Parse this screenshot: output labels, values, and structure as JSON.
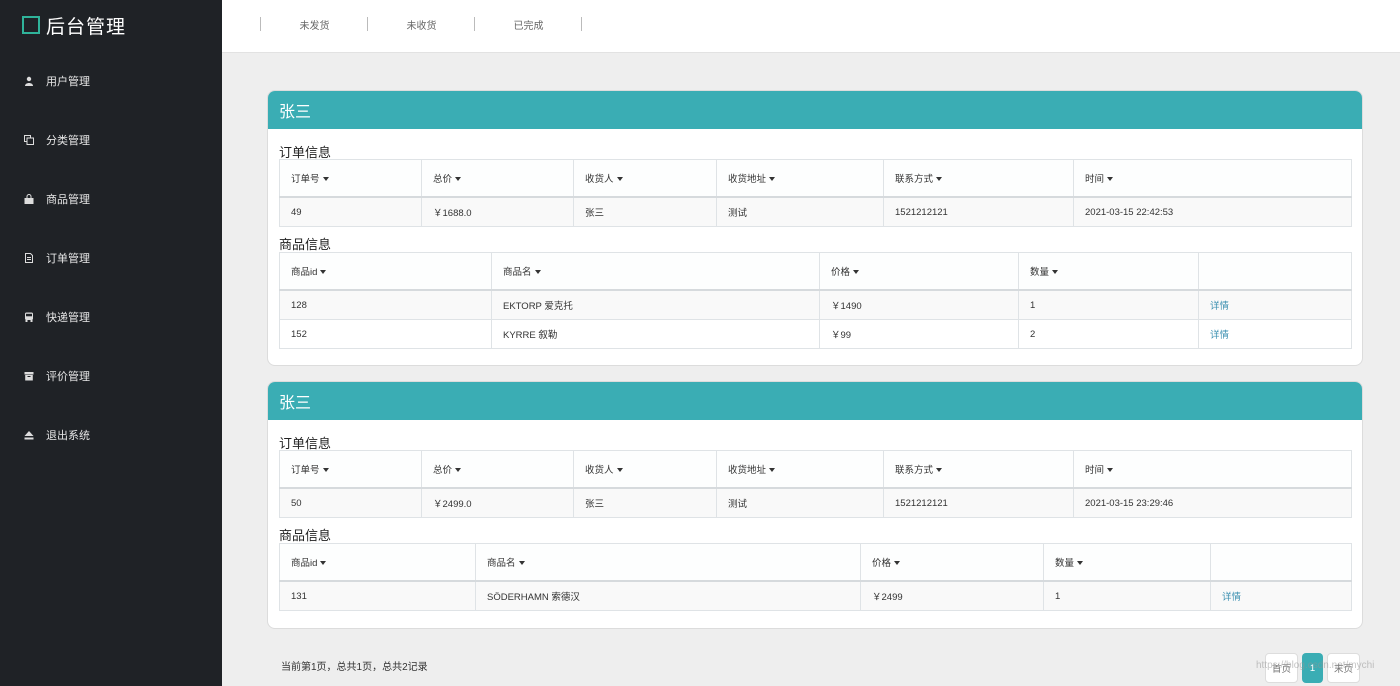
{
  "app": {
    "title": "后台管理"
  },
  "sidebar": {
    "items": [
      {
        "label": "用户管理",
        "icon": "user-icon"
      },
      {
        "label": "分类管理",
        "icon": "copy-icon"
      },
      {
        "label": "商品管理",
        "icon": "shopping-bag-icon"
      },
      {
        "label": "订单管理",
        "icon": "document-icon"
      },
      {
        "label": "快递管理",
        "icon": "bus-icon"
      },
      {
        "label": "评价管理",
        "icon": "archive-icon"
      },
      {
        "label": "退出系统",
        "icon": "eject-icon"
      }
    ]
  },
  "topbar": {
    "tabs": [
      "未发货",
      "未收货",
      "已完成"
    ]
  },
  "orders": [
    {
      "customer": "张三",
      "order_section_title": "订单信息",
      "order_headers": [
        "订单号",
        "总价",
        "收货人",
        "收货地址",
        "联系方式",
        "时间"
      ],
      "order_row": [
        "49",
        "￥1688.0",
        "张三",
        "测试",
        "1521212121",
        "2021-03-15 22:42:53"
      ],
      "product_section_title": "商品信息",
      "product_headers": [
        "商品id",
        "商品名",
        "价格",
        "数量"
      ],
      "products": [
        {
          "id": "128",
          "name": "EKTORP 爱克托",
          "price": "￥1490",
          "qty": "1",
          "link": "详情"
        },
        {
          "id": "152",
          "name": "KYRRE 叙勒",
          "price": "￥99",
          "qty": "2",
          "link": "详情"
        }
      ]
    },
    {
      "customer": "张三",
      "order_section_title": "订单信息",
      "order_headers": [
        "订单号",
        "总价",
        "收货人",
        "收货地址",
        "联系方式",
        "时间"
      ],
      "order_row": [
        "50",
        "￥2499.0",
        "张三",
        "测试",
        "1521212121",
        "2021-03-15 23:29:46"
      ],
      "product_section_title": "商品信息",
      "product_headers": [
        "商品id",
        "商品名",
        "价格",
        "数量"
      ],
      "products": [
        {
          "id": "131",
          "name": "SÖDERHAMN 索德汉",
          "price": "￥2499",
          "qty": "1",
          "link": "详情"
        }
      ]
    }
  ],
  "pagination": {
    "info": "当前第1页，总共1页，总共2记录",
    "first": "首页",
    "current": "1",
    "last": "末页"
  },
  "watermark": "https://blog.csdn.net/mychi"
}
